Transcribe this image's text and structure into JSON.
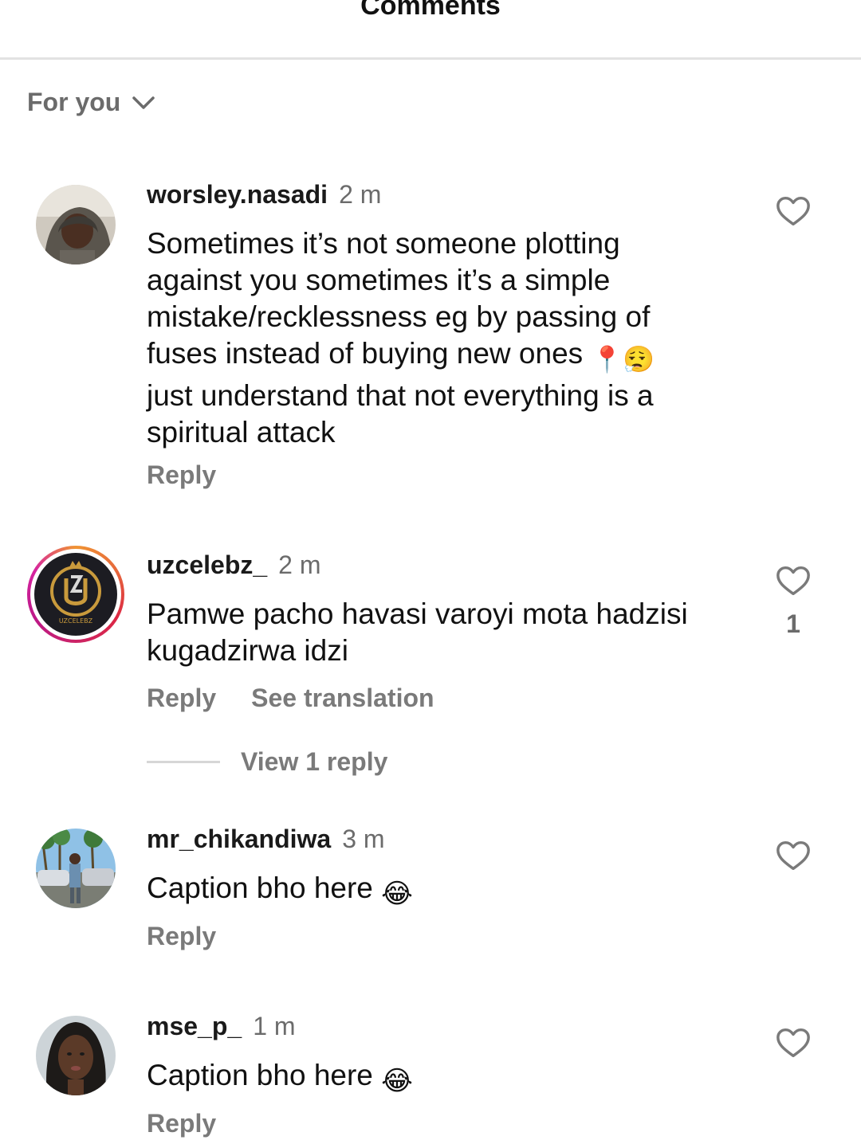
{
  "header": {
    "title": "Comments"
  },
  "sort": {
    "label": "For you",
    "icon": "chevron-down-icon"
  },
  "comments": [
    {
      "username": "worsley.nasadi",
      "time": "2 m",
      "text_lines": [
        "Sometimes it’s not someone plotting",
        "against you sometimes it’s a simple",
        "mistake/recklessness  eg by passing of",
        "fuses instead of buying new ones",
        "just understand that  not everything is a",
        "spiritual attack"
      ],
      "emojis": [
        "📍",
        "😮‍💨"
      ],
      "reply_label": "Reply",
      "avatar_icon": "user-avatar"
    },
    {
      "username": "uzcelebz_",
      "time": "2 m",
      "text_lines": [
        "Pamwe pacho havasi varoyi mota hadzisi",
        "kugadzirwa idzi"
      ],
      "reply_label": "Reply",
      "translate_label": "See translation",
      "like_count": "1",
      "view_replies_label": "View 1 reply",
      "avatar_icon": "uzcelebz-logo-avatar",
      "logo_text": "UZCELEBZ"
    },
    {
      "username": "mr_chikandiwa",
      "time": "3 m",
      "text": "Caption bho here",
      "emoji": "😂",
      "reply_label": "Reply",
      "avatar_icon": "user-avatar"
    },
    {
      "username": "mse_p_",
      "time": "1 m",
      "text": "Caption bho here",
      "emoji": "😂",
      "reply_label": "Reply",
      "avatar_icon": "user-avatar"
    }
  ]
}
